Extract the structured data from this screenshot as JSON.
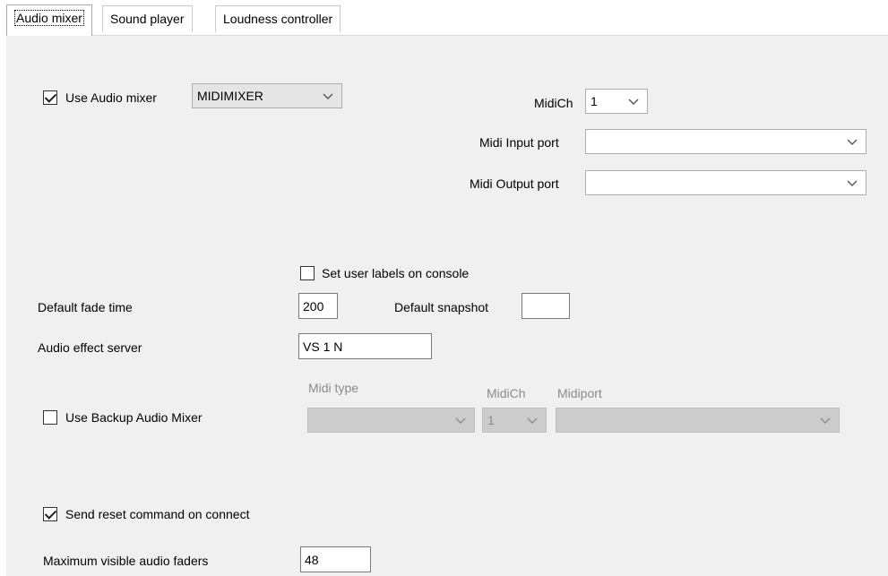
{
  "tabs": [
    {
      "label": "Audio mixer"
    },
    {
      "label": "Sound player"
    },
    {
      "label": "Loudness controller"
    }
  ],
  "use_audio_mixer": {
    "label": "Use Audio mixer",
    "checked": true,
    "selected": "MIDIMIXER"
  },
  "midi": {
    "channel_label": "MidiCh",
    "channel_value": "1",
    "input_port_label": "Midi Input port",
    "input_port_value": "",
    "output_port_label": "Midi Output port",
    "output_port_value": ""
  },
  "set_user_labels": {
    "label": "Set user labels on console",
    "checked": false
  },
  "default_fade_time": {
    "label": "Default fade time",
    "value": "200"
  },
  "default_snapshot": {
    "label": "Default snapshot",
    "value": ""
  },
  "audio_effect_server": {
    "label": "Audio effect server",
    "value": "VS 1 N"
  },
  "backup_mixer": {
    "label": "Use Backup Audio Mixer",
    "checked": false,
    "midi_type_label": "Midi type",
    "midi_type_value": "",
    "midich_label": "MidiCh",
    "midich_value": "1",
    "midiport_label": "Midiport",
    "midiport_value": ""
  },
  "send_reset": {
    "label": "Send reset command on connect",
    "checked": true
  },
  "max_faders": {
    "label": "Maximum visible audio faders",
    "value": "48"
  },
  "icons": {
    "dropdown": "chevron-down-icon",
    "checkmark": "check-icon"
  }
}
